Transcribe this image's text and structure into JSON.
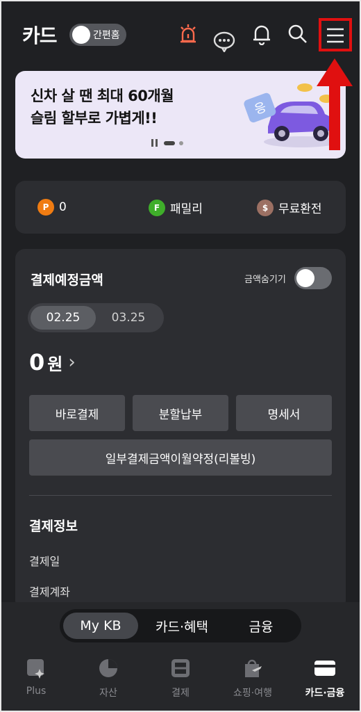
{
  "header": {
    "title": "카드",
    "simple_home_label": "간편홈",
    "icons": [
      "alert-siren-icon",
      "chatbot-icon",
      "bell-icon",
      "search-icon",
      "menu-icon"
    ]
  },
  "banner": {
    "line1": "신차 살 땐 최대 60개월",
    "line2": "슬림 할부로 가볍게!!",
    "coin_text": "응"
  },
  "points": [
    {
      "badge": "P",
      "label": "0",
      "color": "#f07c12"
    },
    {
      "badge": "F",
      "label": "패밀리",
      "color": "#3fae2a"
    },
    {
      "badge": "$",
      "label": "무료환전",
      "color": "#9c7063"
    }
  ],
  "payment": {
    "title": "결제예정금액",
    "hide_label": "금액숨기기",
    "months": [
      "02.25",
      "03.25"
    ],
    "amount": "0",
    "amount_unit": "원",
    "buttons": [
      "바로결제",
      "분할납부",
      "명세서"
    ],
    "wide_button": "일부결제금액이월약정(리볼빙)",
    "info_title": "결제정보",
    "info_rows": [
      "결제일",
      "결제계좌"
    ]
  },
  "segments": [
    "My KB",
    "카드·혜택",
    "금융"
  ],
  "tabs": [
    "Plus",
    "자산",
    "결제",
    "쇼핑·여행",
    "카드·금융"
  ],
  "colors": {
    "background": "#1f2023",
    "card": "#2c2d31",
    "highlight": "#e01010",
    "banner": "#ece7f7"
  }
}
